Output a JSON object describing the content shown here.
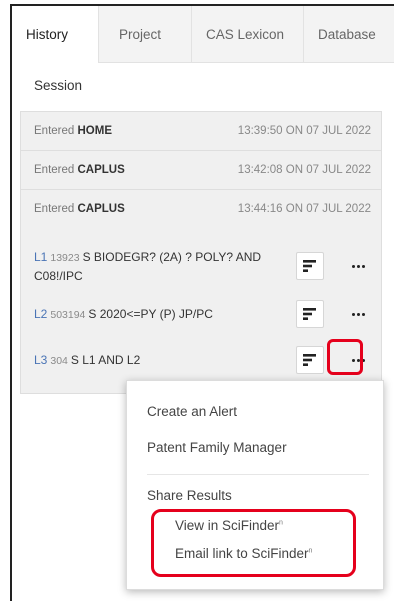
{
  "tabs": [
    {
      "label": "History",
      "active": true
    },
    {
      "label": "Project",
      "active": false
    },
    {
      "label": "CAS Lexicon",
      "active": false
    },
    {
      "label": "Database",
      "active": false
    }
  ],
  "session": {
    "label": "Session"
  },
  "entries": [
    {
      "prefix": "Entered",
      "name": "HOME",
      "time": "13:39:50 ON 07 JUL 2022"
    },
    {
      "prefix": "Entered",
      "name": "CAPLUS",
      "time": "13:42:08 ON 07 JUL 2022"
    },
    {
      "prefix": "Entered",
      "name": "CAPLUS",
      "time": "13:44:16 ON 07 JUL 2022"
    }
  ],
  "queries": [
    {
      "id": "L1",
      "count": "13923",
      "text": "S BIODEGR? (2A) ? POLY? AND C08!/IPC"
    },
    {
      "id": "L2",
      "count": "503194",
      "text": "S 2020<=PY (P) JP/PC"
    },
    {
      "id": "L3",
      "count": "304",
      "text": "S L1 AND L2"
    }
  ],
  "menu": {
    "items": [
      "Create an Alert",
      "Patent Family Manager"
    ],
    "share_label": "Share Results",
    "sub_items": [
      {
        "label": "View in SciFinder",
        "mark": "n"
      },
      {
        "label": "Email link to SciFinder",
        "mark": "n"
      }
    ]
  },
  "colors": {
    "accent_link": "#4a74b5",
    "highlight": "#e5001c"
  }
}
